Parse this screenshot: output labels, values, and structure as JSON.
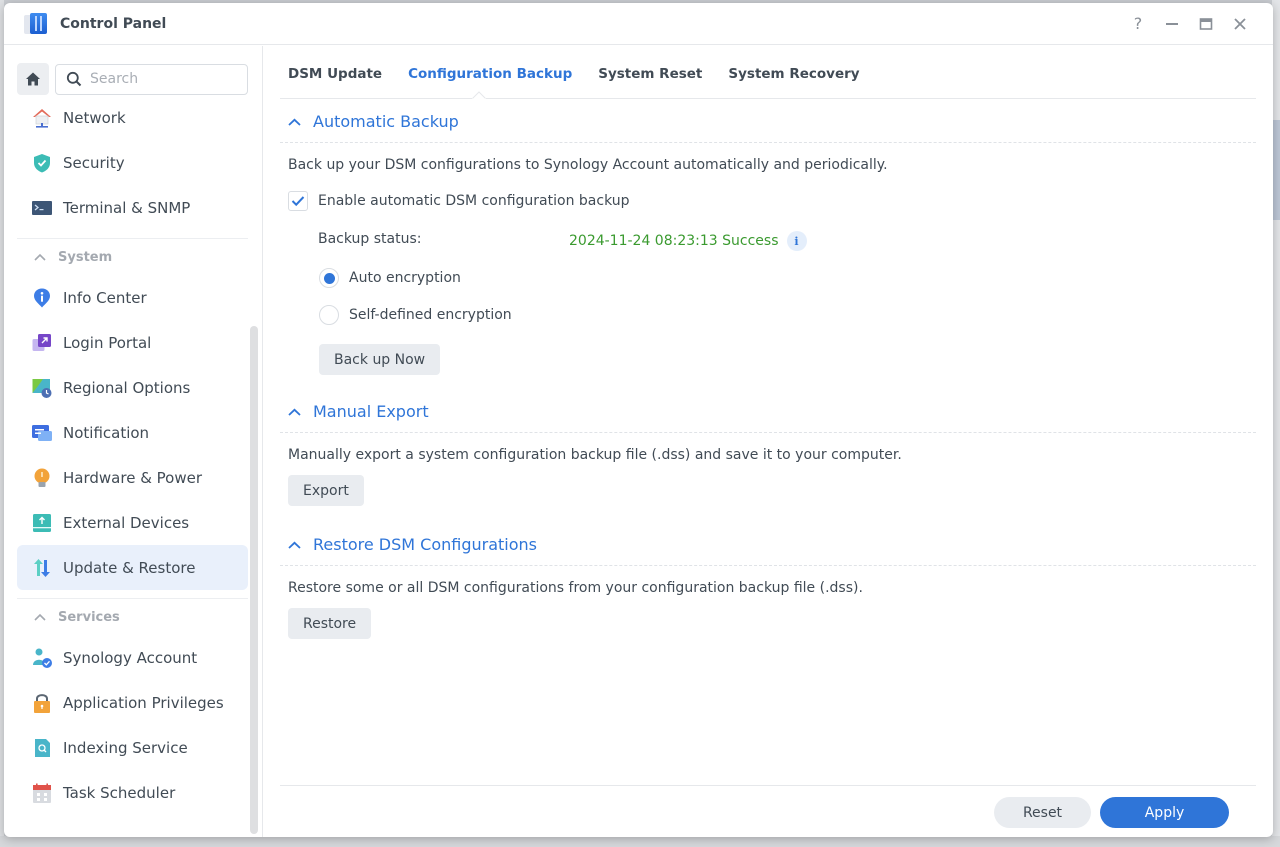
{
  "window": {
    "title": "Control Panel",
    "controls": [
      {
        "name": "help",
        "icon": "question-icon",
        "glyph": "?"
      },
      {
        "name": "minimize",
        "icon": "minimize-icon"
      },
      {
        "name": "maximize",
        "icon": "maximize-icon"
      },
      {
        "name": "close",
        "icon": "close-icon"
      }
    ]
  },
  "sidebar": {
    "search_placeholder": "Search",
    "search_value": "",
    "items_top": [
      {
        "label": "Network",
        "icon": "network-icon"
      },
      {
        "label": "Security",
        "icon": "security-shield-icon"
      },
      {
        "label": "Terminal & SNMP",
        "icon": "terminal-icon"
      }
    ],
    "groups": [
      {
        "label": "System",
        "items": [
          {
            "label": "Info Center",
            "icon": "info-center-icon"
          },
          {
            "label": "Login Portal",
            "icon": "login-portal-icon"
          },
          {
            "label": "Regional Options",
            "icon": "regional-options-icon"
          },
          {
            "label": "Notification",
            "icon": "notification-icon"
          },
          {
            "label": "Hardware & Power",
            "icon": "hardware-power-icon"
          },
          {
            "label": "External Devices",
            "icon": "external-devices-icon"
          },
          {
            "label": "Update & Restore",
            "icon": "update-restore-icon",
            "active": true
          }
        ]
      },
      {
        "label": "Services",
        "items": [
          {
            "label": "Synology Account",
            "icon": "synology-account-icon"
          },
          {
            "label": "Application Privileges",
            "icon": "application-privileges-icon"
          },
          {
            "label": "Indexing Service",
            "icon": "indexing-service-icon"
          },
          {
            "label": "Task Scheduler",
            "icon": "task-scheduler-icon"
          }
        ]
      }
    ]
  },
  "tabs": [
    {
      "label": "DSM Update",
      "active": false
    },
    {
      "label": "Configuration Backup",
      "active": true
    },
    {
      "label": "System Reset",
      "active": false
    },
    {
      "label": "System Recovery",
      "active": false
    }
  ],
  "sections": {
    "auto_backup": {
      "title": "Automatic Backup",
      "description": "Back up your DSM configurations to Synology Account automatically and periodically.",
      "enable_label": "Enable automatic DSM configuration backup",
      "enable_checked": true,
      "status_label": "Backup status:",
      "status_value": "2024-11-24 08:23:13 Success",
      "encryption_options": [
        {
          "label": "Auto encryption",
          "checked": true
        },
        {
          "label": "Self-defined encryption",
          "checked": false
        }
      ],
      "backup_now_label": "Back up Now"
    },
    "manual_export": {
      "title": "Manual Export",
      "description": "Manually export a system configuration backup file (.dss) and save it to your computer.",
      "button_label": "Export"
    },
    "restore": {
      "title": "Restore DSM Configurations",
      "description": "Restore some or all DSM configurations from your configuration backup file (.dss).",
      "button_label": "Restore"
    }
  },
  "footer": {
    "reset_label": "Reset",
    "apply_label": "Apply"
  },
  "colors": {
    "accent": "#2f75d8",
    "success": "#3a9a2f",
    "active_item_bg": "#e9f0fb"
  }
}
